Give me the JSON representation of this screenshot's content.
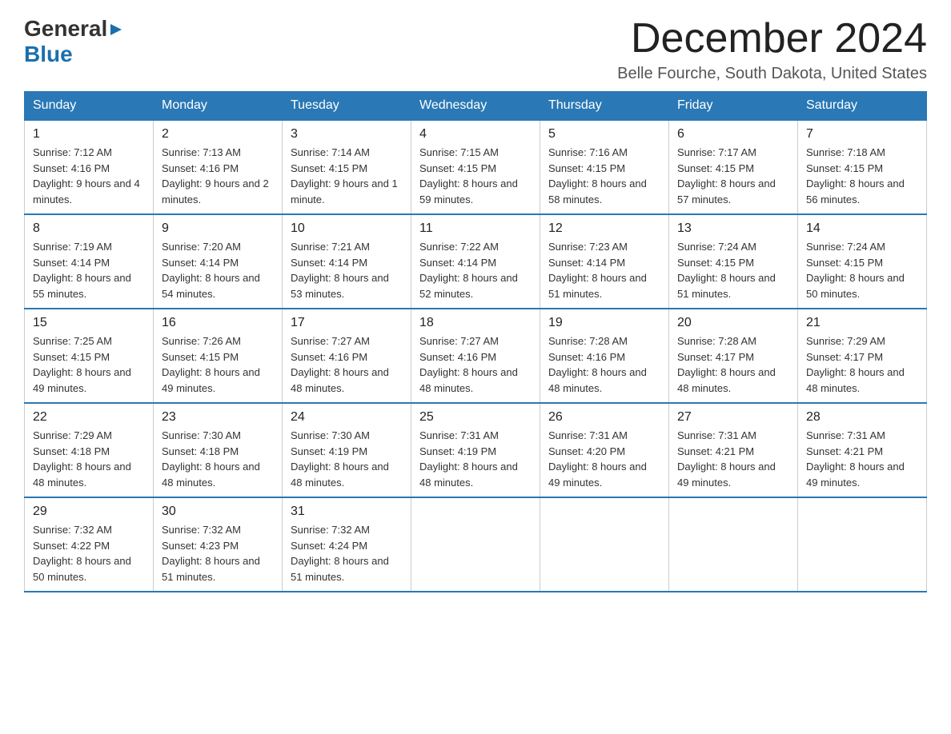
{
  "header": {
    "logo": {
      "general": "General",
      "blue": "Blue",
      "arrow_symbol": "▶"
    },
    "title": "December 2024",
    "subtitle": "Belle Fourche, South Dakota, United States"
  },
  "calendar": {
    "days_of_week": [
      "Sunday",
      "Monday",
      "Tuesday",
      "Wednesday",
      "Thursday",
      "Friday",
      "Saturday"
    ],
    "weeks": [
      [
        {
          "day": "1",
          "sunrise": "7:12 AM",
          "sunset": "4:16 PM",
          "daylight": "9 hours and 4 minutes."
        },
        {
          "day": "2",
          "sunrise": "7:13 AM",
          "sunset": "4:16 PM",
          "daylight": "9 hours and 2 minutes."
        },
        {
          "day": "3",
          "sunrise": "7:14 AM",
          "sunset": "4:15 PM",
          "daylight": "9 hours and 1 minute."
        },
        {
          "day": "4",
          "sunrise": "7:15 AM",
          "sunset": "4:15 PM",
          "daylight": "8 hours and 59 minutes."
        },
        {
          "day": "5",
          "sunrise": "7:16 AM",
          "sunset": "4:15 PM",
          "daylight": "8 hours and 58 minutes."
        },
        {
          "day": "6",
          "sunrise": "7:17 AM",
          "sunset": "4:15 PM",
          "daylight": "8 hours and 57 minutes."
        },
        {
          "day": "7",
          "sunrise": "7:18 AM",
          "sunset": "4:15 PM",
          "daylight": "8 hours and 56 minutes."
        }
      ],
      [
        {
          "day": "8",
          "sunrise": "7:19 AM",
          "sunset": "4:14 PM",
          "daylight": "8 hours and 55 minutes."
        },
        {
          "day": "9",
          "sunrise": "7:20 AM",
          "sunset": "4:14 PM",
          "daylight": "8 hours and 54 minutes."
        },
        {
          "day": "10",
          "sunrise": "7:21 AM",
          "sunset": "4:14 PM",
          "daylight": "8 hours and 53 minutes."
        },
        {
          "day": "11",
          "sunrise": "7:22 AM",
          "sunset": "4:14 PM",
          "daylight": "8 hours and 52 minutes."
        },
        {
          "day": "12",
          "sunrise": "7:23 AM",
          "sunset": "4:14 PM",
          "daylight": "8 hours and 51 minutes."
        },
        {
          "day": "13",
          "sunrise": "7:24 AM",
          "sunset": "4:15 PM",
          "daylight": "8 hours and 51 minutes."
        },
        {
          "day": "14",
          "sunrise": "7:24 AM",
          "sunset": "4:15 PM",
          "daylight": "8 hours and 50 minutes."
        }
      ],
      [
        {
          "day": "15",
          "sunrise": "7:25 AM",
          "sunset": "4:15 PM",
          "daylight": "8 hours and 49 minutes."
        },
        {
          "day": "16",
          "sunrise": "7:26 AM",
          "sunset": "4:15 PM",
          "daylight": "8 hours and 49 minutes."
        },
        {
          "day": "17",
          "sunrise": "7:27 AM",
          "sunset": "4:16 PM",
          "daylight": "8 hours and 48 minutes."
        },
        {
          "day": "18",
          "sunrise": "7:27 AM",
          "sunset": "4:16 PM",
          "daylight": "8 hours and 48 minutes."
        },
        {
          "day": "19",
          "sunrise": "7:28 AM",
          "sunset": "4:16 PM",
          "daylight": "8 hours and 48 minutes."
        },
        {
          "day": "20",
          "sunrise": "7:28 AM",
          "sunset": "4:17 PM",
          "daylight": "8 hours and 48 minutes."
        },
        {
          "day": "21",
          "sunrise": "7:29 AM",
          "sunset": "4:17 PM",
          "daylight": "8 hours and 48 minutes."
        }
      ],
      [
        {
          "day": "22",
          "sunrise": "7:29 AM",
          "sunset": "4:18 PM",
          "daylight": "8 hours and 48 minutes."
        },
        {
          "day": "23",
          "sunrise": "7:30 AM",
          "sunset": "4:18 PM",
          "daylight": "8 hours and 48 minutes."
        },
        {
          "day": "24",
          "sunrise": "7:30 AM",
          "sunset": "4:19 PM",
          "daylight": "8 hours and 48 minutes."
        },
        {
          "day": "25",
          "sunrise": "7:31 AM",
          "sunset": "4:19 PM",
          "daylight": "8 hours and 48 minutes."
        },
        {
          "day": "26",
          "sunrise": "7:31 AM",
          "sunset": "4:20 PM",
          "daylight": "8 hours and 49 minutes."
        },
        {
          "day": "27",
          "sunrise": "7:31 AM",
          "sunset": "4:21 PM",
          "daylight": "8 hours and 49 minutes."
        },
        {
          "day": "28",
          "sunrise": "7:31 AM",
          "sunset": "4:21 PM",
          "daylight": "8 hours and 49 minutes."
        }
      ],
      [
        {
          "day": "29",
          "sunrise": "7:32 AM",
          "sunset": "4:22 PM",
          "daylight": "8 hours and 50 minutes."
        },
        {
          "day": "30",
          "sunrise": "7:32 AM",
          "sunset": "4:23 PM",
          "daylight": "8 hours and 51 minutes."
        },
        {
          "day": "31",
          "sunrise": "7:32 AM",
          "sunset": "4:24 PM",
          "daylight": "8 hours and 51 minutes."
        },
        null,
        null,
        null,
        null
      ]
    ]
  }
}
